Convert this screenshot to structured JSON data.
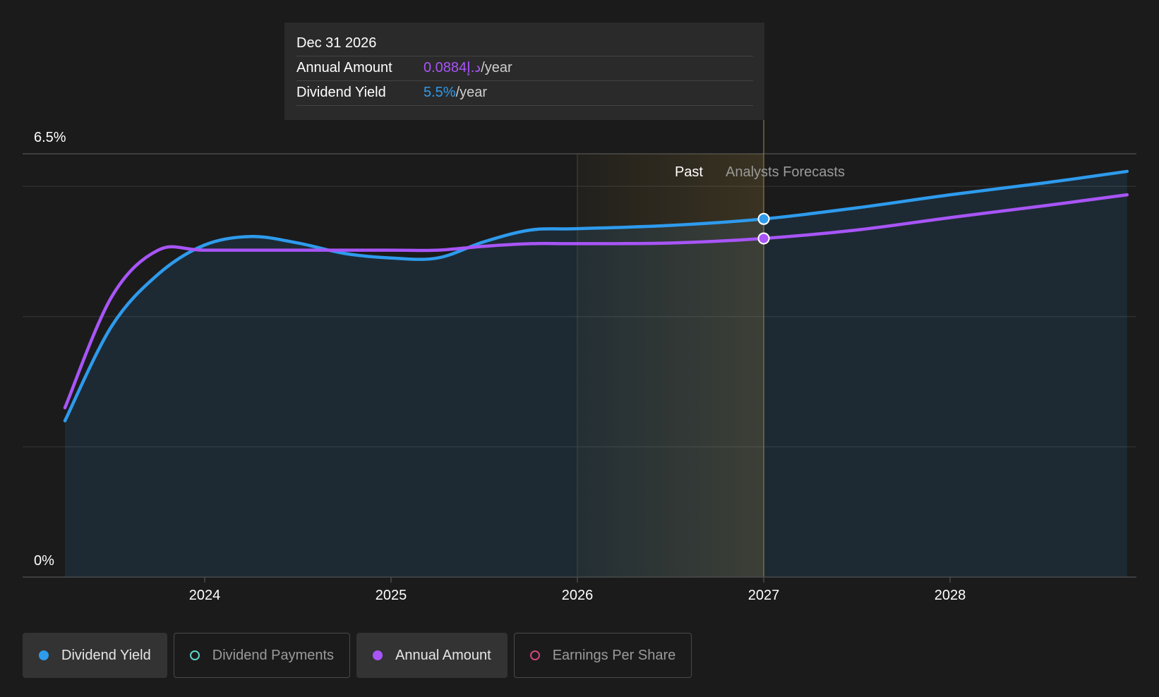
{
  "tooltip": {
    "date": "Dec 31 2026",
    "rows": [
      {
        "label": "Annual Amount",
        "value": "0.0884د.إ",
        "unit": "/year"
      },
      {
        "label": "Dividend Yield",
        "value": "5.5%",
        "unit": "/year"
      }
    ]
  },
  "legend": {
    "items": [
      {
        "label": "Dividend Yield",
        "color": "#2e9bed",
        "active": true
      },
      {
        "label": "Dividend Payments",
        "color": "#5fd3c5",
        "active": false
      },
      {
        "label": "Annual Amount",
        "color": "#a855f7",
        "active": true
      },
      {
        "label": "Earnings Per Share",
        "color": "#d0477e",
        "active": false
      }
    ]
  },
  "chart_data": {
    "type": "line",
    "title": "",
    "xlabel": "",
    "ylabel": "",
    "y_axis_labels": [
      "6.5%",
      "0%"
    ],
    "ylim": [
      0,
      6.5
    ],
    "xlim": [
      2023.25,
      2028.95
    ],
    "x_ticks": [
      2024,
      2025,
      2026,
      2027,
      2028
    ],
    "x_tick_labels": [
      "2024",
      "2025",
      "2026",
      "2027",
      "2028"
    ],
    "grid": true,
    "region_labels": {
      "past": "Past",
      "forecast": "Analysts Forecasts"
    },
    "past_region": [
      2026.0,
      2027.0
    ],
    "divider_x": 2027.0,
    "highlight_x": 2027.0,
    "series": [
      {
        "name": "Dividend Yield",
        "color": "#2e9bed",
        "x": [
          2023.25,
          2023.5,
          2023.75,
          2024.0,
          2024.25,
          2024.5,
          2024.75,
          2025.0,
          2025.25,
          2025.5,
          2025.75,
          2026.0,
          2026.5,
          2027.0,
          2027.5,
          2028.0,
          2028.5,
          2028.95
        ],
        "y": [
          2.4,
          3.85,
          4.65,
          5.1,
          5.23,
          5.13,
          4.97,
          4.9,
          4.9,
          5.15,
          5.33,
          5.35,
          5.4,
          5.5,
          5.67,
          5.87,
          6.05,
          6.23
        ]
      },
      {
        "name": "Annual Amount",
        "color": "#a855f7",
        "x": [
          2023.25,
          2023.5,
          2023.75,
          2024.0,
          2024.5,
          2025.0,
          2025.25,
          2025.5,
          2025.75,
          2026.0,
          2026.5,
          2027.0,
          2027.5,
          2028.0,
          2028.5,
          2028.95
        ],
        "y": [
          2.6,
          4.3,
          5.02,
          5.02,
          5.02,
          5.02,
          5.02,
          5.08,
          5.12,
          5.12,
          5.13,
          5.2,
          5.33,
          5.52,
          5.7,
          5.87
        ]
      }
    ]
  }
}
